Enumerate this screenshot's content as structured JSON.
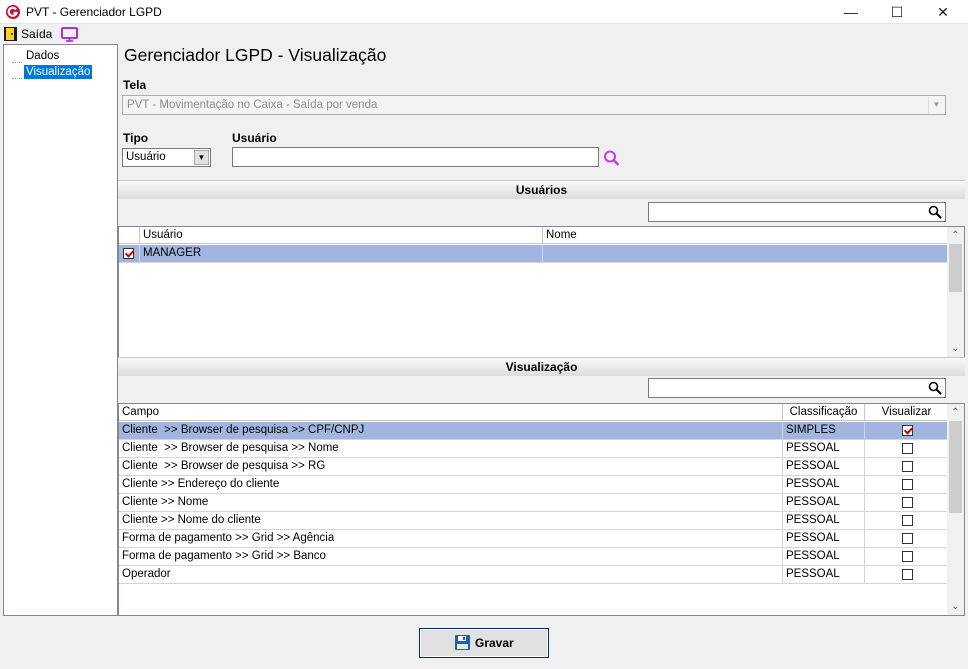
{
  "window": {
    "title": "PVT - Gerenciador LGPD",
    "minimize": "—",
    "maximize": "☐",
    "close": "✕"
  },
  "menu": {
    "exit_label": "Saída",
    "exit_icon": "exit-door-icon",
    "screen_icon": "monitor-icon"
  },
  "tree": {
    "items": [
      {
        "label": "Dados",
        "selected": false
      },
      {
        "label": "Visualização",
        "selected": true
      }
    ]
  },
  "page": {
    "heading": "Gerenciador LGPD - Visualização"
  },
  "form": {
    "tela_label": "Tela",
    "tela_value": "PVT - Movimentação no Caixa - Saída por venda",
    "tipo_label": "Tipo",
    "tipo_value": "Usuário",
    "usuario_label": "Usuário",
    "usuario_value": ""
  },
  "users_section": {
    "title": "Usuários",
    "filter_value": "",
    "columns": [
      "Usuário",
      "Nome"
    ],
    "rows": [
      {
        "checked": true,
        "usuario": "MANAGER",
        "nome": ""
      }
    ]
  },
  "view_section": {
    "title": "Visualização",
    "filter_value": "",
    "columns": [
      "Campo",
      "Classificação",
      "Visualizar"
    ],
    "rows": [
      {
        "campo": "Cliente  >> Browser de pesquisa >> CPF/CNPJ",
        "classificacao": "SIMPLES",
        "visualizar": true
      },
      {
        "campo": "Cliente  >> Browser de pesquisa >> Nome",
        "classificacao": "PESSOAL",
        "visualizar": false
      },
      {
        "campo": "Cliente  >> Browser de pesquisa >> RG",
        "classificacao": "PESSOAL",
        "visualizar": false
      },
      {
        "campo": "Cliente >> Endereço do cliente",
        "classificacao": "PESSOAL",
        "visualizar": false
      },
      {
        "campo": "Cliente >> Nome",
        "classificacao": "PESSOAL",
        "visualizar": false
      },
      {
        "campo": "Cliente >> Nome do cliente",
        "classificacao": "PESSOAL",
        "visualizar": false
      },
      {
        "campo": "Forma de pagamento >> Grid >> Agência",
        "classificacao": "PESSOAL",
        "visualizar": false
      },
      {
        "campo": "Forma de pagamento >> Grid >> Banco",
        "classificacao": "PESSOAL",
        "visualizar": false
      },
      {
        "campo": "Operador",
        "classificacao": "PESSOAL",
        "visualizar": false
      }
    ]
  },
  "footer": {
    "save_label": "Gravar",
    "save_icon": "floppy-disk-icon"
  },
  "colors": {
    "selection_row": "#a2b5e1",
    "tree_selection": "#0078d7",
    "check_mark": "#d00000",
    "lookup_icon": "#c13fd6"
  }
}
